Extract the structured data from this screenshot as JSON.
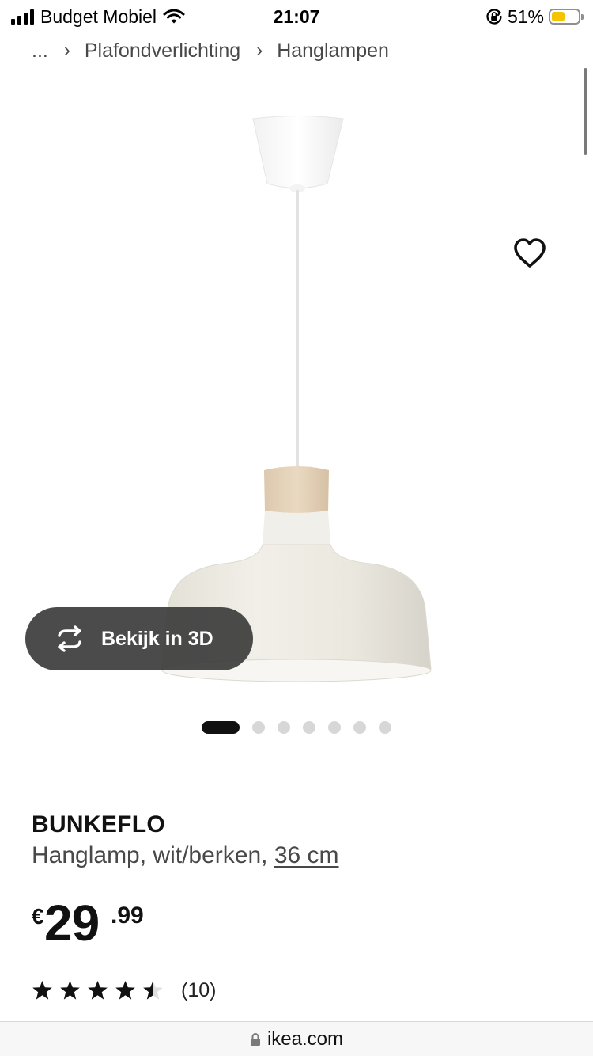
{
  "status_bar": {
    "carrier": "Budget Mobiel",
    "time": "21:07",
    "battery_percent": "51%",
    "battery_level": 0.51,
    "icons": [
      "signal-icon",
      "wifi-icon",
      "orientation-lock-icon",
      "battery-icon"
    ]
  },
  "breadcrumb": {
    "ellipsis": "...",
    "items": [
      "Plafondverlichting",
      "Hanglampen"
    ],
    "separator_icon": "chevron-right-icon"
  },
  "gallery": {
    "wishlist_icon": "heart-outline-icon",
    "view_3d_label": "Bekijk in 3D",
    "view_3d_icon": "rotate-3d-icon",
    "image_count": 7,
    "active_index": 0
  },
  "product": {
    "name": "BUNKEFLO",
    "description": "Hanglamp, wit/berken,",
    "size_link": "36 cm",
    "price": {
      "currency": "€",
      "integer": "29",
      "decimal": ".99"
    },
    "rating": {
      "value": 4.5,
      "max": 5,
      "count_label": "(10)"
    }
  },
  "url_bar": {
    "domain": "ikea.com",
    "lock_icon": "lock-icon"
  },
  "colors": {
    "text": "#111111",
    "muted_text": "#484848",
    "overlay": "#3c3c3c",
    "battery": "#f5c400"
  }
}
